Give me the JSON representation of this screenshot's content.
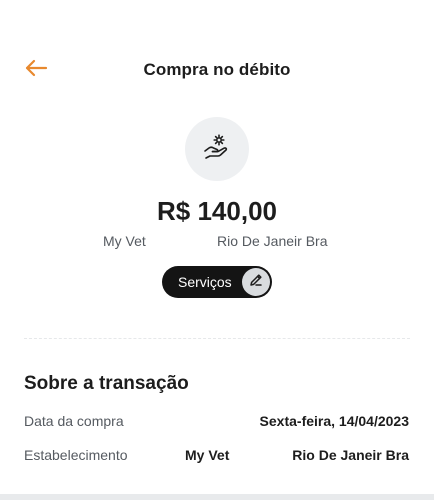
{
  "header": {
    "title": "Compra no débito",
    "back_icon": "arrow-left-icon",
    "accent_color": "#e8892e"
  },
  "transaction": {
    "category_icon": "hand-gear-icon",
    "amount": "R$ 140,00",
    "merchant_name": "My Vet",
    "merchant_city": "Rio De Janeir Bra",
    "category_label": "Serviços",
    "edit_icon": "pencil-icon"
  },
  "details": {
    "section_title": "Sobre a transação",
    "rows": [
      {
        "label": "Data da compra",
        "value": "Sexta-feira, 14/04/2023"
      },
      {
        "label": "Estabelecimento",
        "value": "My Vet",
        "value2": "Rio De Janeir Bra"
      }
    ]
  }
}
